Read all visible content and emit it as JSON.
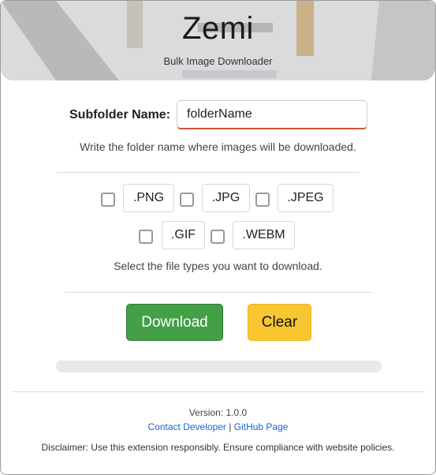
{
  "header": {
    "title": "Zemi",
    "subtitle": "Bulk Image Downloader"
  },
  "folder": {
    "label": "Subfolder Name:",
    "value": "folderName",
    "help": "Write the folder name where images will be downloaded."
  },
  "file_types": {
    "options": [
      {
        "label": ".PNG",
        "checked": false
      },
      {
        "label": ".JPG",
        "checked": false
      },
      {
        "label": ".JPEG",
        "checked": false
      },
      {
        "label": ".GIF",
        "checked": false
      },
      {
        "label": ".WEBM",
        "checked": false
      }
    ],
    "help": "Select the file types you want to download."
  },
  "actions": {
    "download_label": "Download",
    "clear_label": "Clear"
  },
  "progress": {
    "value": 0
  },
  "footer": {
    "version": "Version: 1.0.0",
    "contact_label": "Contact Developer",
    "separator": "|",
    "github_label": "GitHub Page",
    "disclaimer": "Disclaimer: Use this extension responsibly. Ensure compliance with website policies."
  },
  "colors": {
    "download": "#43a046",
    "clear": "#f7c631",
    "link": "#1a63d6",
    "input_underline": "#d2553b"
  }
}
